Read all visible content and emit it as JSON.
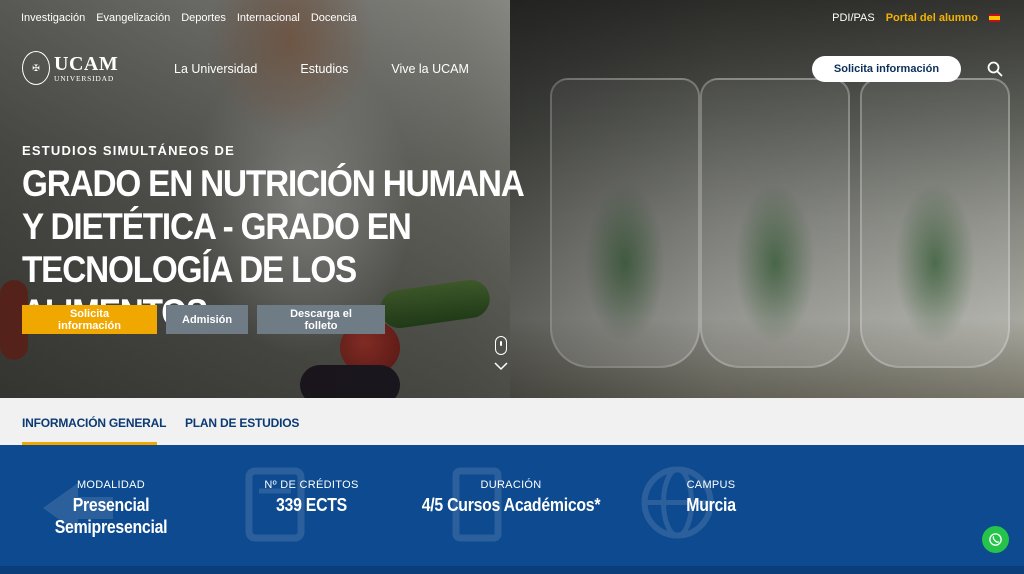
{
  "topbar": {
    "links": [
      "Investigación",
      "Evangelización",
      "Deportes",
      "Internacional",
      "Docencia"
    ],
    "pdi": "PDI/PAS",
    "portal": "Portal del alumno"
  },
  "logo": {
    "main": "UCAM",
    "sub": "UNIVERSIDAD"
  },
  "nav": {
    "items": [
      "La Universidad",
      "Estudios",
      "Vive la UCAM"
    ],
    "cta": "Solicita información"
  },
  "hero": {
    "eyebrow": "ESTUDIOS SIMULTÁNEOS DE",
    "title": "GRADO EN NUTRICIÓN HUMANA Y DIETÉTICA - GRADO EN TECNOLOGÍA DE LOS ALIMENTOS",
    "buttons": [
      "Solicita información",
      "Admisión",
      "Descarga el folleto"
    ]
  },
  "tabs": [
    "INFORMACIÓN GENERAL",
    "PLAN DE ESTUDIOS"
  ],
  "info": [
    {
      "label": "MODALIDAD",
      "value": "Presencial",
      "value2": "Semipresencial"
    },
    {
      "label": "Nº DE CRÉDITOS",
      "value": "339 ECTS"
    },
    {
      "label": "DURACIÓN",
      "value": "4/5 Cursos Académicos*"
    },
    {
      "label": "CAMPUS",
      "value": "Murcia"
    }
  ],
  "colors": {
    "accent": "#f0a800",
    "brand_blue": "#0d4a8f",
    "tab_text": "#0b3a74",
    "whatsapp": "#25c34a"
  }
}
